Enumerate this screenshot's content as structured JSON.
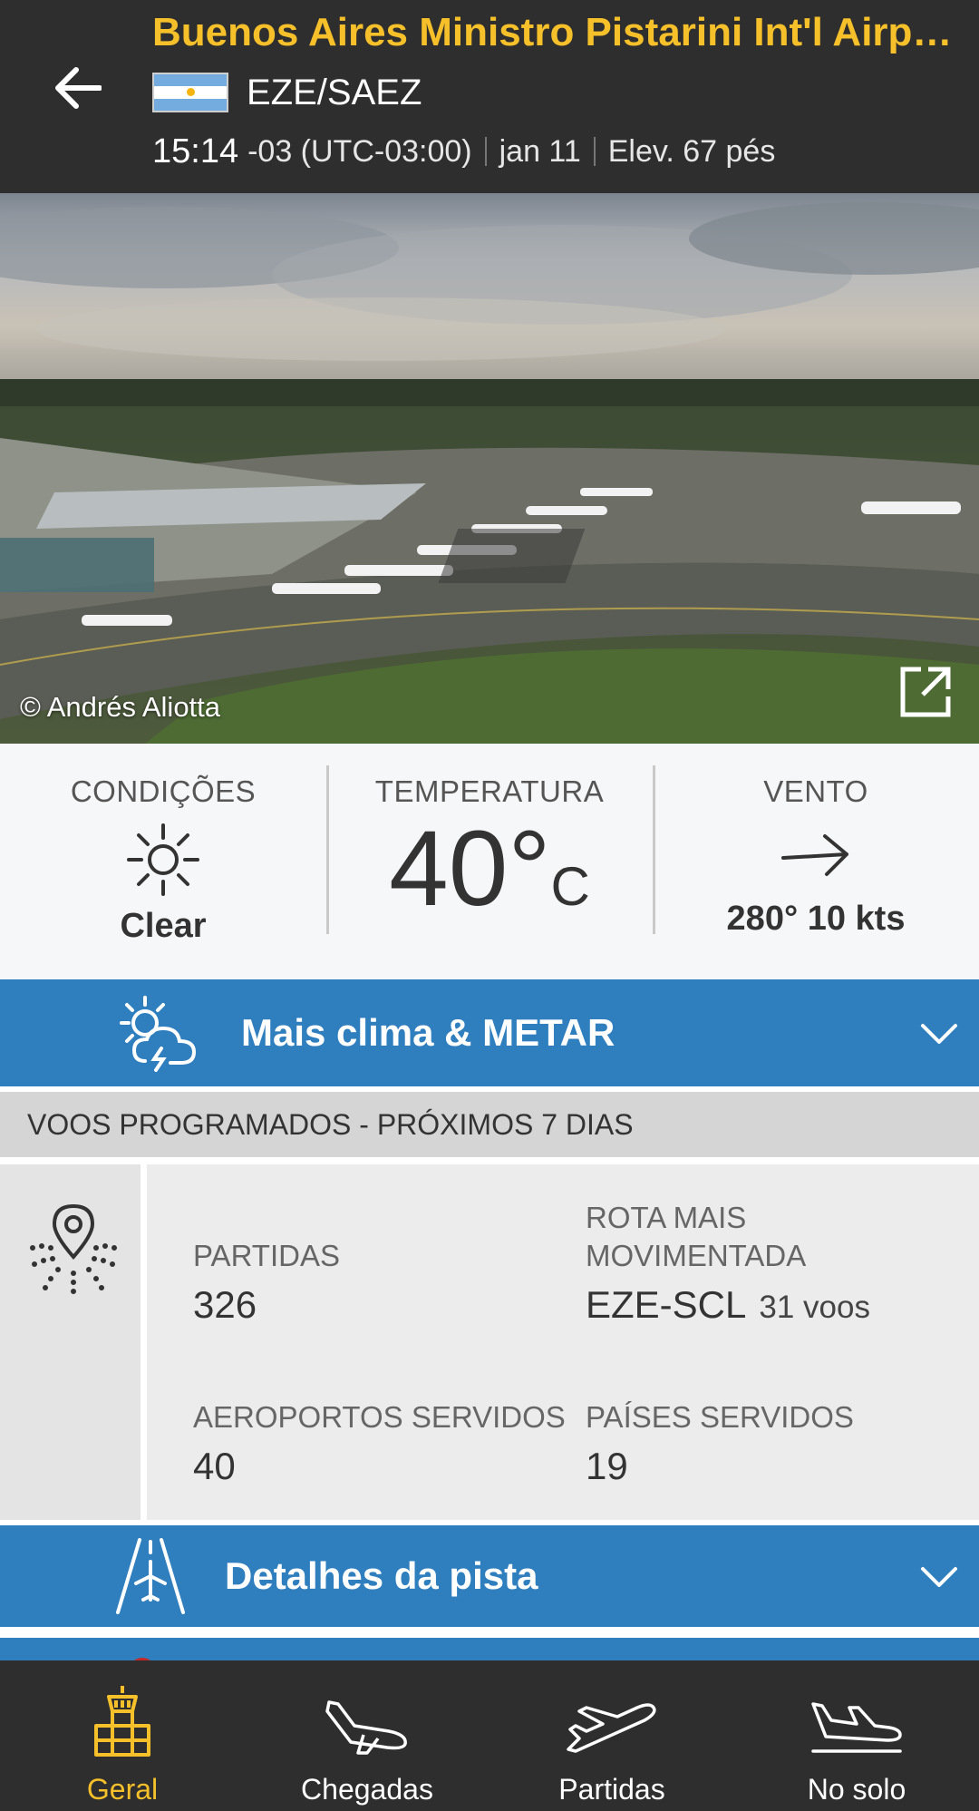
{
  "header": {
    "title": "Buenos Aires Ministro Pistarini Int'l Airp…",
    "codes": "EZE/SAEZ",
    "time": "15:14",
    "timezone": "-03 (UTC-03:00)",
    "date": "jan 11",
    "elevation": "Elev. 67 pés",
    "flag_country": "Argentina",
    "accent_color": "#f5c02a"
  },
  "photo": {
    "credit": "© Andrés Aliotta"
  },
  "weather": {
    "conditions_label": "CONDIÇÕES",
    "conditions_value": "Clear",
    "temperature_label": "TEMPERATURA",
    "temperature_value": "40°",
    "temperature_unit": "C",
    "wind_label": "VENTO",
    "wind_value": "280° 10 kts"
  },
  "more_weather": {
    "label": "Mais clima & METAR",
    "color": "#2f7fbf"
  },
  "scheduled": {
    "header": "VOOS PROGRAMADOS - PRÓXIMOS 7 DIAS",
    "departures_label": "PARTIDAS",
    "departures_value": "326",
    "busiest_route_label_line1": "ROTA MAIS",
    "busiest_route_label_line2": "MOVIMENTADA",
    "busiest_route_value": "EZE-SCL",
    "busiest_route_count": "31 voos",
    "airports_label": "AEROPORTOS SERVIDOS",
    "airports_value": "40",
    "countries_label": "PAÍSES SERVIDOS",
    "countries_value": "19"
  },
  "runway": {
    "label": "Detalhes da pista"
  },
  "bottom_nav": {
    "items": [
      {
        "label": "Geral",
        "icon": "tower-icon",
        "active": true
      },
      {
        "label": "Chegadas",
        "icon": "arrival-plane-icon",
        "active": false
      },
      {
        "label": "Partidas",
        "icon": "departure-plane-icon",
        "active": false
      },
      {
        "label": "No solo",
        "icon": "ground-plane-icon",
        "active": false
      }
    ]
  }
}
